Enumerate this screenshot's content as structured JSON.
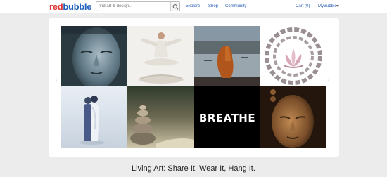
{
  "header": {
    "logo_part1": "red",
    "logo_part2": "bubble",
    "search_placeholder": "find art & design...",
    "search_icon": "search-icon",
    "nav": {
      "explore": "Explore",
      "shop": "Shop",
      "community": "Community"
    },
    "cart": "Cart (0)",
    "account": "MyBubble",
    "account_icon": "chevron-down-icon"
  },
  "gallery": {
    "breathe_text": "BREATHE",
    "prev_icon": "chevron-left-icon",
    "next_icon": "chevron-right-icon"
  },
  "tagline": "Living Art: Share It, Wear It, Hang It.",
  "colors": {
    "logo_red": "#e0312f",
    "logo_blue": "#1f5fbf",
    "link": "#2a62b8",
    "background": "#ececec"
  }
}
